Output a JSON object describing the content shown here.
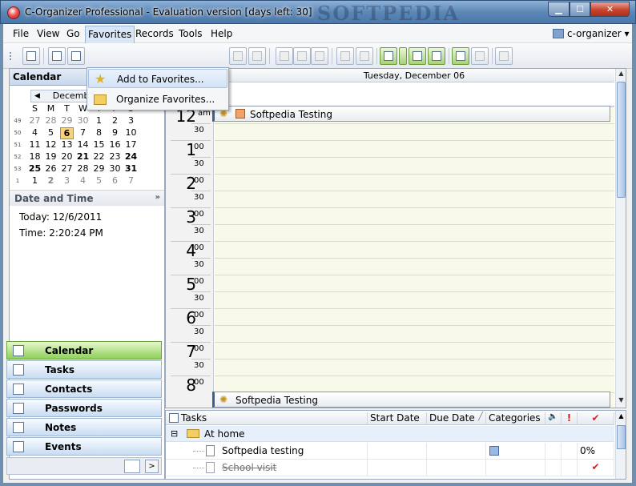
{
  "window": {
    "title": "C-Organizer Professional - Evaluation version [days left: 30]",
    "watermark": "SOFTPEDIA",
    "minimize": "▁",
    "maximize": "☐",
    "close": "✕"
  },
  "menu": {
    "file": "File",
    "view": "View",
    "go": "Go",
    "favorites": "Favorites",
    "records": "Records",
    "tools": "Tools",
    "help": "Help",
    "profile": "c-organizer ▾"
  },
  "favorites_menu": {
    "add": "Add to Favorites...",
    "organize": "Organize Favorites..."
  },
  "calendar": {
    "header": "Calendar",
    "month": "December 2011",
    "prev": "◀",
    "next": "▶",
    "weekday_headers": [
      "S",
      "M",
      "T",
      "W",
      "T",
      "F",
      "S"
    ],
    "weeks": [
      {
        "wk": "49",
        "days": [
          "27",
          "28",
          "29",
          "30",
          "1",
          "2",
          "3"
        ]
      },
      {
        "wk": "50",
        "days": [
          "4",
          "5",
          "6",
          "7",
          "8",
          "9",
          "10"
        ]
      },
      {
        "wk": "51",
        "days": [
          "11",
          "12",
          "13",
          "14",
          "15",
          "16",
          "17"
        ]
      },
      {
        "wk": "52",
        "days": [
          "18",
          "19",
          "20",
          "21",
          "22",
          "23",
          "24"
        ]
      },
      {
        "wk": "53",
        "days": [
          "25",
          "26",
          "27",
          "28",
          "29",
          "30",
          "31"
        ]
      },
      {
        "wk": "1",
        "days": [
          "1",
          "2",
          "3",
          "4",
          "5",
          "6",
          "7"
        ]
      }
    ]
  },
  "date_time": {
    "header": "Date and Time",
    "today": "Today: 12/6/2011",
    "time": "Time: 2:20:24 PM"
  },
  "nav": {
    "calendar": "Calendar",
    "tasks": "Tasks",
    "contacts": "Contacts",
    "passwords": "Passwords",
    "notes": "Notes",
    "events": "Events",
    "more": ">"
  },
  "day_view": {
    "date": "Tuesday, December 06",
    "hours": [
      {
        "h": "12",
        "ampm": "am",
        "half": "30"
      },
      {
        "h": "1",
        "ampm": "00",
        "half": "30"
      },
      {
        "h": "2",
        "ampm": "00",
        "half": "30"
      },
      {
        "h": "3",
        "ampm": "00",
        "half": "30"
      },
      {
        "h": "4",
        "ampm": "00",
        "half": "30"
      },
      {
        "h": "5",
        "ampm": "00",
        "half": "30"
      },
      {
        "h": "6",
        "ampm": "00",
        "half": "30"
      },
      {
        "h": "7",
        "ampm": "00",
        "half": "30"
      },
      {
        "h": "8",
        "ampm": "00",
        "half": ""
      }
    ],
    "appointments": [
      {
        "title": "Softpedia Testing"
      },
      {
        "title": "Softpedia Testing"
      }
    ]
  },
  "tasks": {
    "columns": {
      "tasks": "Tasks",
      "start_date": "Start Date",
      "due_date": "Due Date",
      "sort": "╱",
      "categories": "Categories",
      "reminder": "🔈",
      "priority": "!",
      "complete": "✔"
    },
    "group": {
      "toggle": "⊟",
      "name": "At home"
    },
    "rows": [
      {
        "name": "Softpedia testing",
        "progress": "0%",
        "done": false
      },
      {
        "name": "School visit",
        "done": true,
        "check": "✔"
      }
    ]
  },
  "colors": {
    "accent": "#8fd05a",
    "titlebar": "#5c87b6",
    "slot_background": "#f8f9e8",
    "category": "#f3a26a"
  }
}
